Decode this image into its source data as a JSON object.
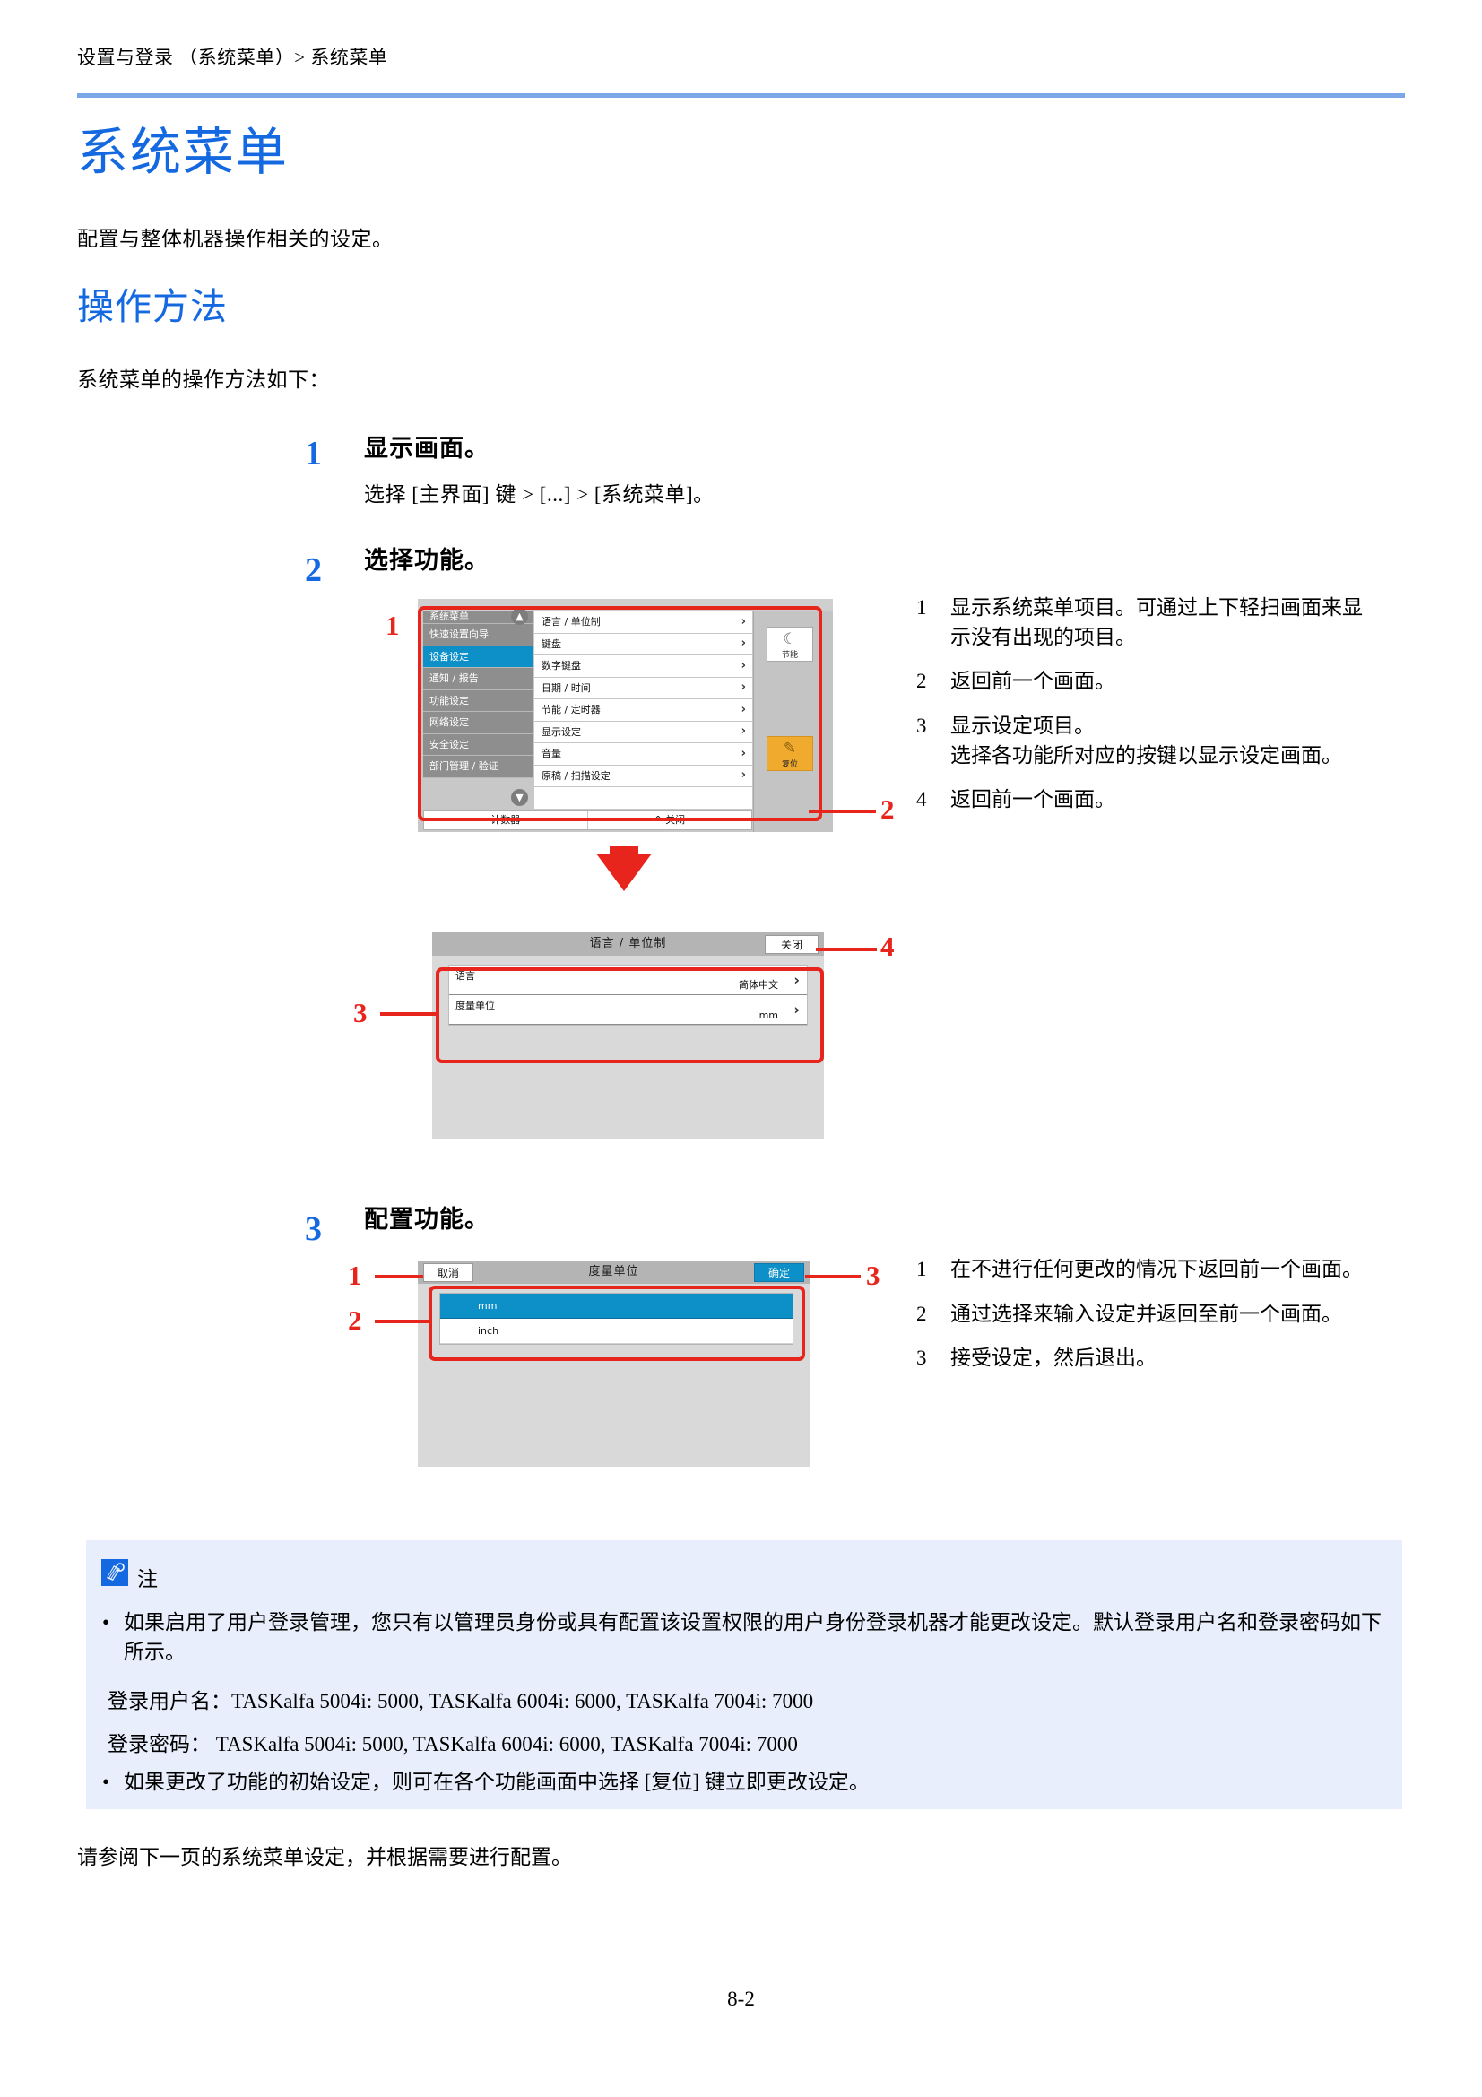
{
  "header": {
    "breadcrumb": "设置与登录 （系统菜单）> 系统菜单"
  },
  "title": "系统菜单",
  "lede": "配置与整体机器操作相关的设定。",
  "section": {
    "heading": "操作方法",
    "intro": "系统菜单的操作方法如下："
  },
  "steps": [
    {
      "number": "1",
      "title": "显示画面。",
      "body": "选择 [主界面] 键 > [...] > [系统菜单]。"
    },
    {
      "number": "2",
      "title": "选择功能。"
    },
    {
      "number": "3",
      "title": "配置功能。"
    }
  ],
  "shot1": {
    "brand": "系统菜单",
    "sidebar": [
      "系统菜单",
      "快速设置向导",
      "设备设定",
      "通知 / 报告",
      "功能设定",
      "网络设定",
      "安全设定",
      "部门管理 / 验证"
    ],
    "selected_sidebar": "设备设定",
    "list": [
      "语言 / 单位制",
      "键盘",
      "数字键盘",
      "日期 / 时间",
      "节能 / 定时器",
      "显示设定",
      "音量",
      "原稿 / 扫描设定"
    ],
    "bottom": [
      "计数器",
      "关闭"
    ],
    "bottom_close_icon": "chevron-up-icon",
    "keys": [
      {
        "icon": "moon-icon",
        "glyph": "☾",
        "label": "节能"
      },
      {
        "icon": "reset-icon",
        "glyph": "✎",
        "label": "复位"
      }
    ],
    "scroll_up": "▲",
    "scroll_down": "▼",
    "callouts": [
      "1",
      "2"
    ]
  },
  "shot2": {
    "title": "语言 / 单位制",
    "close_label": "关闭",
    "rows": [
      {
        "label": "语言",
        "value": "简体中文"
      },
      {
        "label": "度量单位",
        "value": "mm"
      }
    ],
    "callouts": [
      "3",
      "4"
    ]
  },
  "shot3": {
    "cancel_label": "取消",
    "title": "度量单位",
    "ok_label": "确定",
    "options": [
      "mm",
      "inch"
    ],
    "selected_option": "mm",
    "callouts": [
      "1",
      "2",
      "3"
    ]
  },
  "annotations_step2": [
    {
      "index": "1",
      "text": "显示系统菜单项目。可通过上下轻扫画面来显示没有出现的项目。"
    },
    {
      "index": "2",
      "text": "返回前一个画面。"
    },
    {
      "index": "3",
      "text": "显示设定项目。\n选择各功能所对应的按键以显示设定画面。"
    },
    {
      "index": "4",
      "text": "返回前一个画面。"
    }
  ],
  "annotations_step3": [
    {
      "index": "1",
      "text": "在不进行任何更改的情况下返回前一个画面。"
    },
    {
      "index": "2",
      "text": "通过选择来输入设定并返回至前一个画面。"
    },
    {
      "index": "3",
      "text": "接受设定，然后退出。"
    }
  ],
  "note": {
    "title": "注",
    "bullets": [
      "如果启用了用户登录管理，您只有以管理员身份或具有配置该设置权限的用户身份登录机器才能更改设定。默认登录用户名和登录密码如下所示。",
      "如果更改了功能的初始设定，则可在各个功能画面中选择 [复位] 键立即更改设定。"
    ],
    "credentials": [
      "登录用户名：TASKalfa 5004i: 5000, TASKalfa 6004i: 6000, TASKalfa 7004i: 7000",
      "登录密码：    TASKalfa 5004i: 5000, TASKalfa 6004i: 6000, TASKalfa 7004i: 7000"
    ]
  },
  "closing": "请参阅下一页的系统菜单设定，并根据需要进行配置。",
  "folio": "8-2",
  "colors": {
    "accent_blue": "#1569e0",
    "rule_blue": "#7ba7e8",
    "callout_red": "#e8251d",
    "ui_blue": "#0d90c8",
    "note_bg": "#e8eefb",
    "amber": "#f0ab2e"
  }
}
